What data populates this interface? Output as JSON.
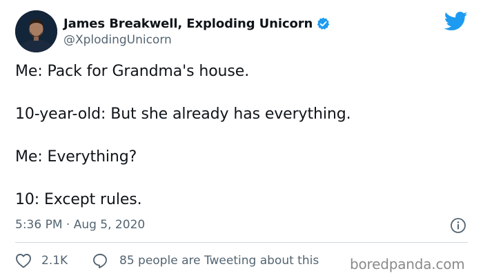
{
  "author": {
    "display_name": "James Breakwell, Exploding Unicorn",
    "handle": "@XplodingUnicorn",
    "verified": true
  },
  "tweet": {
    "lines": [
      "Me: Pack for Grandma's house.",
      "10-year-old: But she already has everything.",
      "Me: Everything?",
      "10: Except rules."
    ],
    "timestamp": "5:36 PM · Aug 5, 2020"
  },
  "engagement": {
    "likes": "2.1K",
    "reply_text": "85 people are Tweeting about this"
  },
  "watermark": "boredpanda.com",
  "icons": {
    "logo": "twitter-bird-icon",
    "verified": "verified-badge-icon",
    "info": "info-icon",
    "like": "heart-icon",
    "reply": "speech-bubble-icon"
  },
  "colors": {
    "twitter_blue": "#1d9bf0",
    "text_primary": "#0f1419",
    "text_secondary": "#536471",
    "divider": "#cfd9de"
  }
}
